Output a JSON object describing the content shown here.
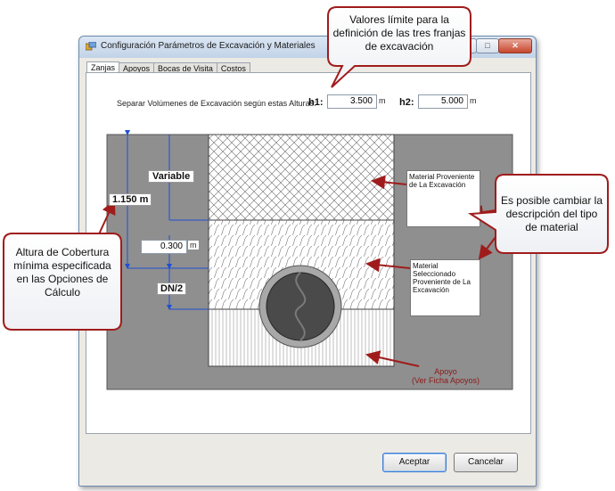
{
  "window": {
    "title": "Configuración Parámetros de Excavación y Materiales",
    "minimize": "—",
    "maximize": "□",
    "close": "✕"
  },
  "tabs": [
    "Zanjas",
    "Apoyos",
    "Bocas de Visita",
    "Costos"
  ],
  "heights": {
    "separator_label": "Separar Volúmenes de Excavación según estas Alturas:",
    "h1_label": "h1:",
    "h1_value": "3.500",
    "h1_unit": "m",
    "h2_label": "h2:",
    "h2_value": "5.000",
    "h2_unit": "m"
  },
  "diagram": {
    "variable_label": "Variable",
    "cover_label": "1.150 m",
    "offset_value": "0.300",
    "offset_unit": "m",
    "dn_label": "DN/2",
    "material_top": "Material Proveniente de La Excavación",
    "material_mid": "Material Seleccionado Proveniente de La Excavación",
    "apoyo_label": "Apoyo",
    "apoyo_sub": "(Ver Ficha Apoyos)"
  },
  "buttons": {
    "accept": "Aceptar",
    "cancel": "Cancelar"
  },
  "annotations": {
    "top": "Valores límite para la definición de las tres franjas de excavación",
    "right": "Es posible cambiar la descripción del tipo de material",
    "left": "Altura de Cobertura mínima especificada en las Opciones de Cálculo"
  },
  "colors": {
    "callout_border": "#a01c1c",
    "arrow": "#a01c1c",
    "dimension_lines": "#1f4fd1",
    "apoyo_text": "#8b1a1a",
    "gray_soil": "#8f8f8f"
  }
}
